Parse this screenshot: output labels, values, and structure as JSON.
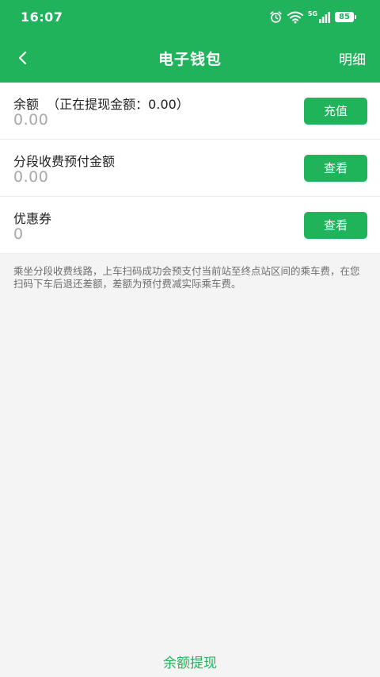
{
  "status_bar": {
    "time": "16:07",
    "network": "5G",
    "battery": "85",
    "icons": [
      "alarm-icon",
      "wifi-icon",
      "signal-icon",
      "battery-icon"
    ]
  },
  "navbar": {
    "title": "电子钱包",
    "detail_label": "明细"
  },
  "balance": {
    "label": "余额  （正在提现金额：0.00）",
    "value": "0.00",
    "button": "充值"
  },
  "prepay": {
    "label": "分段收费预付金额",
    "value": "0.00",
    "button": "查看"
  },
  "coupon": {
    "label": "优惠券",
    "value": "0",
    "button": "查看"
  },
  "note": "乘坐分段收费线路，上车扫码成功会预支付当前站至终点站区间的乘车费，在您扫码下车后退还差额，差额为预付费减实际乘车费。",
  "withdraw_label": "余额提现",
  "colors": {
    "primary": "#21b35b",
    "button": "#1fb35a",
    "background": "#f4f4f4",
    "value_gray": "#a8a8a8"
  }
}
